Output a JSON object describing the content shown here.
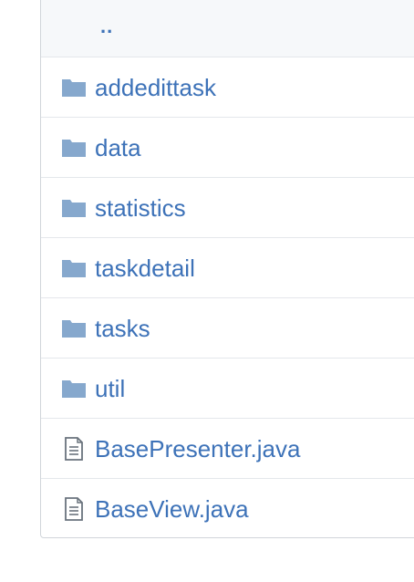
{
  "parent_link": "..",
  "colors": {
    "link": "#3d72b8",
    "folder_icon": "#86a8cd",
    "file_icon": "#6a737d",
    "border": "#d1d5da",
    "parent_row_bg": "#f6f8fa"
  },
  "entries": [
    {
      "name": "addedittask",
      "type": "folder",
      "icon": "folder-icon"
    },
    {
      "name": "data",
      "type": "folder",
      "icon": "folder-icon"
    },
    {
      "name": "statistics",
      "type": "folder",
      "icon": "folder-icon"
    },
    {
      "name": "taskdetail",
      "type": "folder",
      "icon": "folder-icon"
    },
    {
      "name": "tasks",
      "type": "folder",
      "icon": "folder-icon"
    },
    {
      "name": "util",
      "type": "folder",
      "icon": "folder-icon"
    },
    {
      "name": "BasePresenter.java",
      "type": "file",
      "icon": "file-icon"
    },
    {
      "name": "BaseView.java",
      "type": "file",
      "icon": "file-icon"
    }
  ]
}
